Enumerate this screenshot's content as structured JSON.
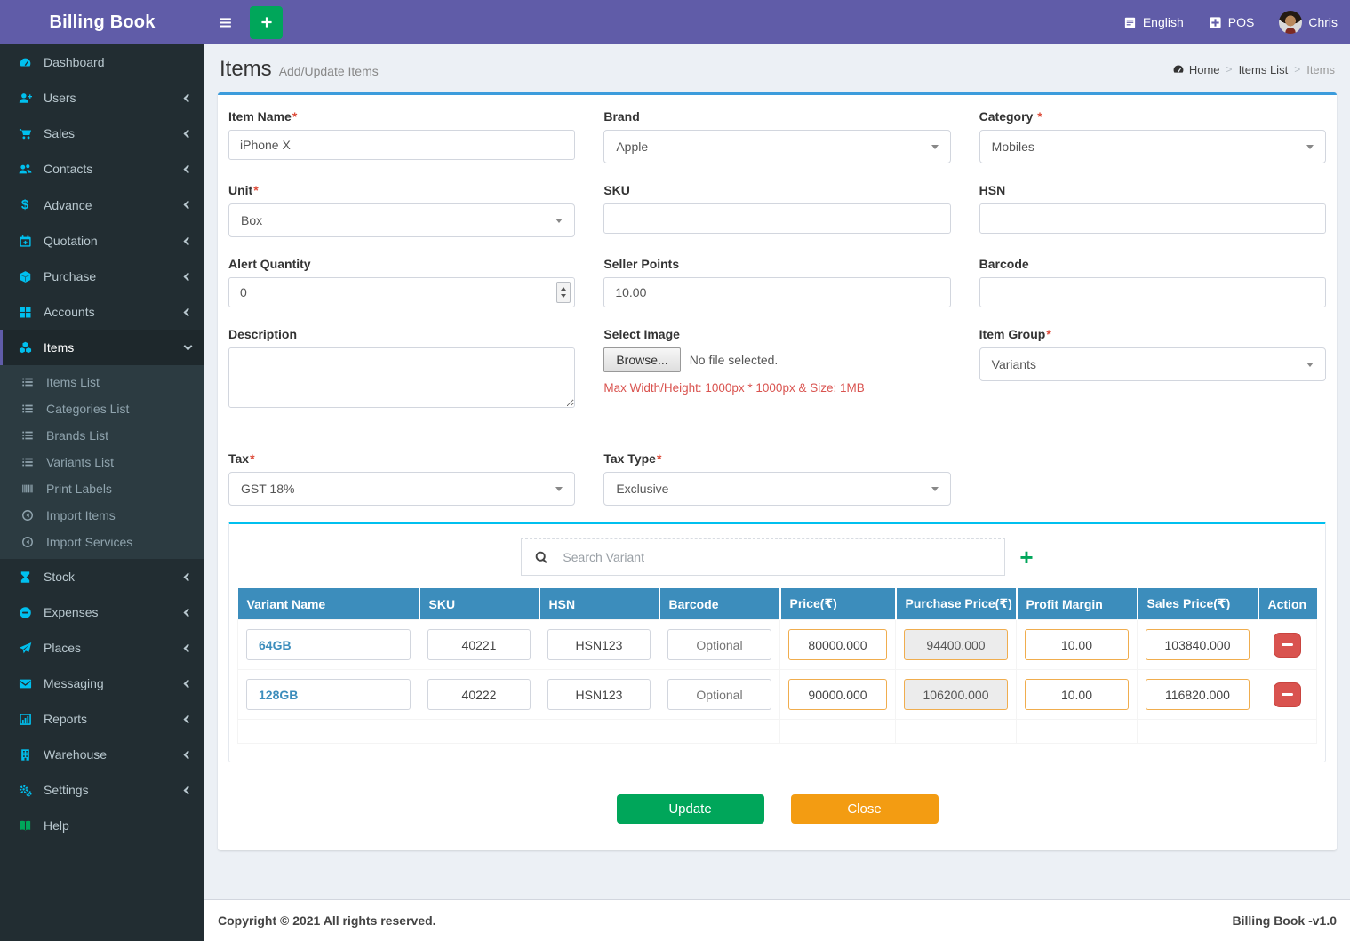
{
  "brand": "Billing Book",
  "topbar": {
    "language": "English",
    "pos": "POS",
    "user": "Chris"
  },
  "page": {
    "title": "Items",
    "subtitle": "Add/Update Items"
  },
  "breadcrumb": {
    "home": "Home",
    "parent": "Items List",
    "current": "Items"
  },
  "required_mark": "*",
  "sidebar": {
    "items": [
      {
        "label": "Dashboard"
      },
      {
        "label": "Users"
      },
      {
        "label": "Sales"
      },
      {
        "label": "Contacts"
      },
      {
        "label": "Advance"
      },
      {
        "label": "Quotation"
      },
      {
        "label": "Purchase"
      },
      {
        "label": "Accounts"
      },
      {
        "label": "Items"
      },
      {
        "label": "Stock"
      },
      {
        "label": "Expenses"
      },
      {
        "label": "Places"
      },
      {
        "label": "Messaging"
      },
      {
        "label": "Reports"
      },
      {
        "label": "Warehouse"
      },
      {
        "label": "Settings"
      },
      {
        "label": "Help"
      }
    ],
    "items_submenu": [
      {
        "label": "Items List"
      },
      {
        "label": "Categories List"
      },
      {
        "label": "Brands List"
      },
      {
        "label": "Variants List"
      },
      {
        "label": "Print Labels"
      },
      {
        "label": "Import Items"
      },
      {
        "label": "Import Services"
      }
    ]
  },
  "form": {
    "item_name": {
      "label": "Item Name",
      "value": "iPhone X"
    },
    "brand": {
      "label": "Brand",
      "value": "Apple"
    },
    "category": {
      "label": "Category",
      "value": "Mobiles"
    },
    "unit": {
      "label": "Unit",
      "value": "Box"
    },
    "sku": {
      "label": "SKU",
      "value": ""
    },
    "hsn": {
      "label": "HSN",
      "value": ""
    },
    "alert_quantity": {
      "label": "Alert Quantity",
      "value": "0"
    },
    "seller_points": {
      "label": "Seller Points",
      "value": "10.00"
    },
    "barcode": {
      "label": "Barcode",
      "value": ""
    },
    "description": {
      "label": "Description",
      "value": ""
    },
    "select_image": {
      "label": "Select Image",
      "browse": "Browse...",
      "file_status": "No file selected.",
      "note": "Max Width/Height: 1000px * 1000px & Size: 1MB"
    },
    "item_group": {
      "label": "Item Group",
      "value": "Variants"
    },
    "tax": {
      "label": "Tax",
      "value": "GST 18%"
    },
    "tax_type": {
      "label": "Tax Type",
      "value": "Exclusive"
    }
  },
  "variants": {
    "search_placeholder": "Search Variant",
    "add_label": "+",
    "columns": [
      "Variant Name",
      "SKU",
      "HSN",
      "Barcode",
      "Price(₹)",
      "Purchase Price(₹)",
      "Profit Margin",
      "Sales Price(₹)",
      "Action"
    ],
    "rows": [
      {
        "name": "64GB",
        "sku": "40221",
        "hsn": "HSN123",
        "barcode_placeholder": "Optional",
        "price": "80000.000",
        "purchase_price": "94400.000",
        "profit_margin": "10.00",
        "sales_price": "103840.000"
      },
      {
        "name": "128GB",
        "sku": "40222",
        "hsn": "HSN123",
        "barcode_placeholder": "Optional",
        "price": "90000.000",
        "purchase_price": "106200.000",
        "profit_margin": "10.00",
        "sales_price": "116820.000"
      }
    ]
  },
  "actions": {
    "update": "Update",
    "close": "Close"
  },
  "footer": {
    "left": "Copyright © 2021 All rights reserved.",
    "right": "Billing Book -v1.0"
  },
  "colors": {
    "header_purple": "#605ca8",
    "sidebar_dark": "#222d32",
    "sidebar_icon_cyan": "#00c0ef",
    "table_header_blue": "#3c8dbc",
    "panel_top_cyan": "#00c0ef",
    "update_green": "#00a65a",
    "close_orange": "#f39c12",
    "danger_red": "#d9534f",
    "price_border_orange": "#f0ad4e"
  }
}
